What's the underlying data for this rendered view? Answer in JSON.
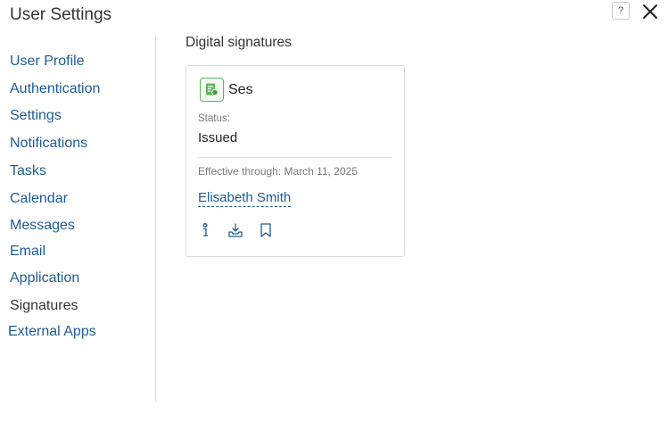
{
  "window": {
    "title": "User Settings",
    "help_label": "?"
  },
  "sidebar": {
    "items": [
      {
        "label": "User Profile"
      },
      {
        "label": "Authentication"
      },
      {
        "label": "Settings"
      },
      {
        "label": "Notifications"
      },
      {
        "label": "Tasks"
      },
      {
        "label": "Calendar"
      },
      {
        "label": "Messages"
      },
      {
        "label": "Email"
      },
      {
        "label": "Application"
      },
      {
        "label": "Signatures",
        "active": true
      },
      {
        "label": "External Apps"
      }
    ]
  },
  "main": {
    "section_title": "Digital signatures",
    "card": {
      "name": "Ses",
      "status_label": "Status:",
      "status_value": "Issued",
      "effective": "Effective through: March 11, 2025",
      "owner": "Elisabeth Smith",
      "actions": [
        {
          "icon": "info-icon"
        },
        {
          "icon": "download-icon"
        },
        {
          "icon": "bookmark-icon"
        }
      ]
    }
  },
  "colors": {
    "link": "#1f5c94",
    "accent_green": "#5cb85c",
    "text": "#333333",
    "muted": "#7a7a7a"
  }
}
